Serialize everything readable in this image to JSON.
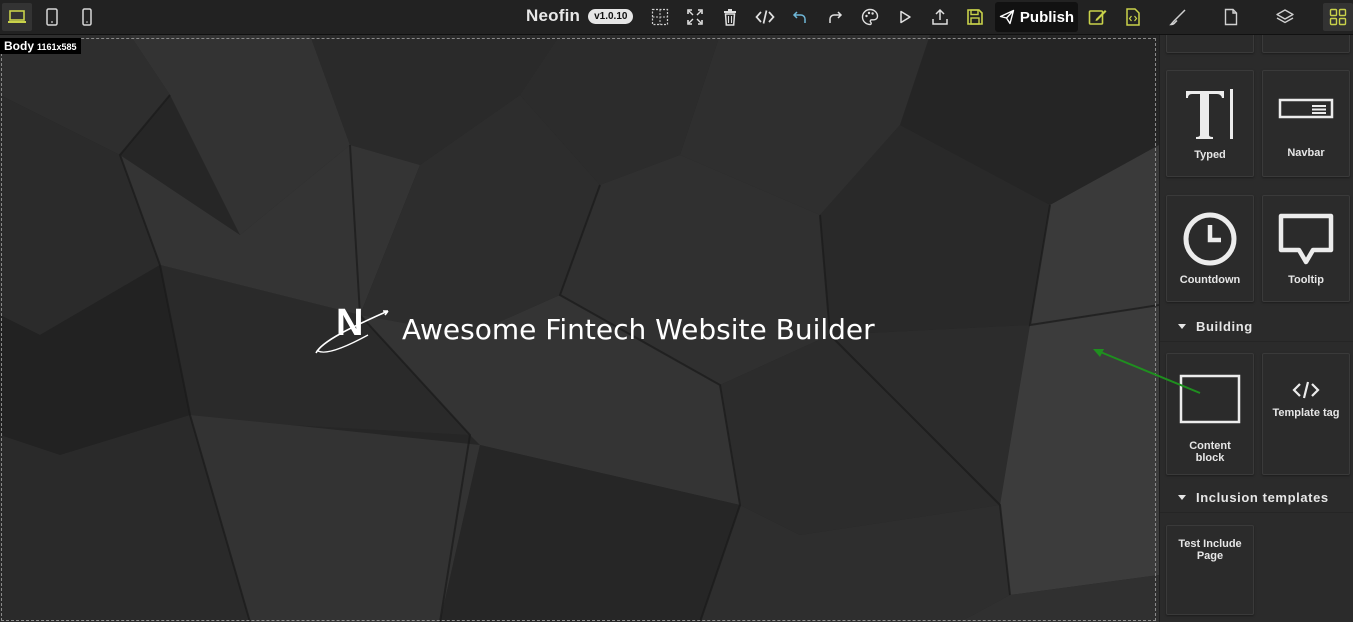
{
  "app": {
    "name": "Neofin",
    "version": "v1.0.10"
  },
  "toolbar": {
    "publish_label": "Publish"
  },
  "canvas": {
    "body_label": "Body",
    "body_size": "1161x585",
    "hero_text": "Awesome Fintech Website Builder",
    "logo_letter": "N"
  },
  "panel": {
    "blocks_top": [
      {
        "label": "Typed",
        "icon": "typed-icon"
      },
      {
        "label": "Navbar",
        "icon": "navbar-icon"
      },
      {
        "label": "Countdown",
        "icon": "clock-icon"
      },
      {
        "label": "Tooltip",
        "icon": "tooltip-icon"
      }
    ],
    "categories": [
      {
        "label": "Building"
      },
      {
        "label": "Inclusion templates"
      }
    ],
    "building_blocks": [
      {
        "label": "Content block",
        "icon": "content-block-icon"
      },
      {
        "label": "Template tag",
        "icon": "code-icon"
      }
    ],
    "inclusion_blocks": [
      {
        "label": "Test Include Page"
      }
    ]
  },
  "colors": {
    "accent": "#c9d24a",
    "toolbar_bg": "#222222",
    "panel_bg": "#2b2b2b",
    "undo_color": "#6fb7d8",
    "annotation_arrow": "#1f8f1f"
  }
}
